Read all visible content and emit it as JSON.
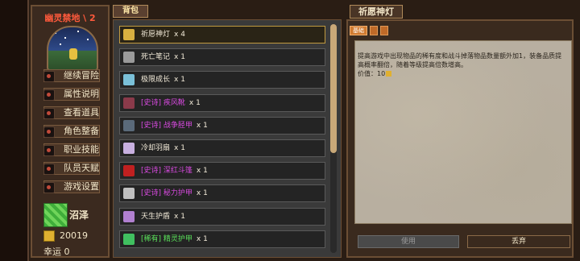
{
  "location": {
    "title": "幽灵禁地 \\ 2"
  },
  "menu": [
    {
      "label": "继续冒险"
    },
    {
      "label": "属性说明"
    },
    {
      "label": "查看道具"
    },
    {
      "label": "角色整备"
    },
    {
      "label": "职业技能"
    },
    {
      "label": "队员天赋"
    },
    {
      "label": "游戏设置"
    }
  ],
  "status": {
    "terrain": "沼泽",
    "gold": "20019",
    "luck": "幸运 0"
  },
  "bag": {
    "tab_label": "背包",
    "items": [
      {
        "prefix": "",
        "name": "祈愿神灯",
        "count": "x 4",
        "quality": "normal",
        "icon": "lamp-icon",
        "color": "#d8b040"
      },
      {
        "prefix": "",
        "name": "死亡笔记",
        "count": "x 1",
        "quality": "normal",
        "icon": "book-icon",
        "color": "#9a9a9a"
      },
      {
        "prefix": "",
        "name": "极限成长",
        "count": "x 1",
        "quality": "normal",
        "icon": "gem-icon",
        "color": "#7ac0d8"
      },
      {
        "prefix": "[史诗]",
        "name": "疾风靴",
        "count": "x 1",
        "quality": "epic",
        "icon": "boots-icon",
        "color": "#8a3a4a"
      },
      {
        "prefix": "[史诗]",
        "name": "战争胫甲",
        "count": "x 1",
        "quality": "epic",
        "icon": "greaves-icon",
        "color": "#5a6a7a"
      },
      {
        "prefix": "",
        "name": "冷却羽扇",
        "count": "x 1",
        "quality": "normal",
        "icon": "fan-icon",
        "color": "#c8b0e0"
      },
      {
        "prefix": "[史诗]",
        "name": "深红斗篷",
        "count": "x 1",
        "quality": "epic",
        "icon": "cloak-icon",
        "color": "#c02020"
      },
      {
        "prefix": "[史诗]",
        "name": "秘力护甲",
        "count": "x 1",
        "quality": "epic",
        "icon": "armor-icon",
        "color": "#c0c0c0"
      },
      {
        "prefix": "",
        "name": "天生护盾",
        "count": "x 1",
        "quality": "normal",
        "icon": "orb-icon",
        "color": "#b080d0"
      },
      {
        "prefix": "[稀有]",
        "name": "精灵护甲",
        "count": "x 1",
        "quality": "rare",
        "icon": "elf-armor-icon",
        "color": "#40c060"
      }
    ]
  },
  "detail": {
    "title": "祈愿神灯",
    "tab_basic": "基础",
    "description": "提高游戏中出现物品的稀有度和战斗掉落物品数量额外加1，装备品质提高概率翻倍，随着等级提高倍数增高。",
    "price": "价值：10",
    "use_label": "使用",
    "drop_label": "丢弃"
  }
}
